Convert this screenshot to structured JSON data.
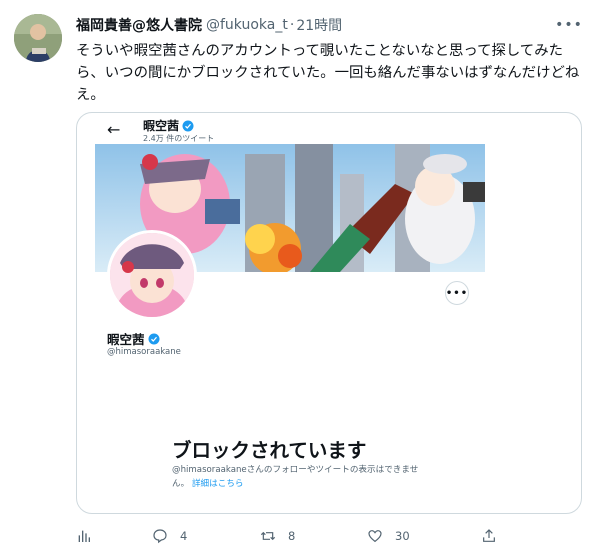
{
  "tweet": {
    "author_name": "福岡貴善@悠人書院",
    "author_handle": "@fukuoka_t",
    "separator": "·",
    "time": "21時間",
    "text": "そういや暇空茜さんのアカウントって覗いたことないなと思って探してみたら、いつの間にかブロックされていた。一回も絡んだ事ないはずなんだけどねえ。"
  },
  "card": {
    "header_name": "暇空茜",
    "header_tweets": "2.4万 件のツイート",
    "profile_name": "暇空茜",
    "profile_handle": "@himasoraakane",
    "blocked_title": "ブロックされています",
    "blocked_desc": "@himasoraakaneさんのフォローやツイートの表示はできません。",
    "blocked_link": "詳細はこちら"
  },
  "actions": {
    "replies": "4",
    "retweets": "8",
    "likes": "30"
  },
  "colors": {
    "accent": "#1d9bf0",
    "text_primary": "#0f1419",
    "text_secondary": "#536471",
    "border": "#cfd9de"
  },
  "icons": [
    "more-icon",
    "back-arrow-icon",
    "verified-icon",
    "analytics-icon",
    "reply-icon",
    "retweet-icon",
    "like-icon",
    "share-icon"
  ]
}
